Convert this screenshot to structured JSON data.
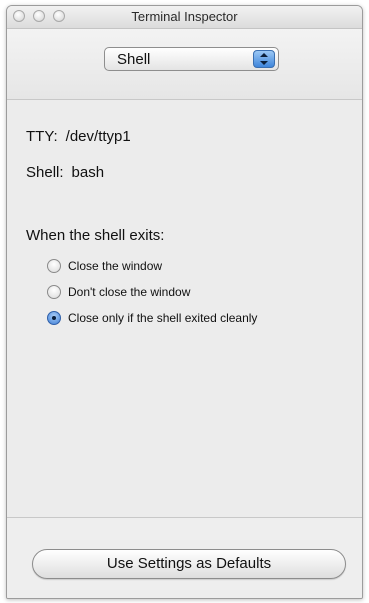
{
  "window": {
    "title": "Terminal Inspector"
  },
  "header": {
    "popup": {
      "selected": "Shell",
      "icon": "up-down-stepper-icon"
    }
  },
  "info": {
    "tty": {
      "label": "TTY:",
      "value": "/dev/ttyp1"
    },
    "shell": {
      "label": "Shell:",
      "value": "bash"
    }
  },
  "exit_options": {
    "heading": "When the shell exits:",
    "options": [
      {
        "label": "Close the window",
        "selected": false
      },
      {
        "label": "Don't close the window",
        "selected": false
      },
      {
        "label": "Close only if the shell exited cleanly",
        "selected": true
      }
    ]
  },
  "footer": {
    "defaults_button": "Use Settings as Defaults"
  },
  "colors": {
    "accent": "#3f86db",
    "window_background": "#ececec"
  }
}
